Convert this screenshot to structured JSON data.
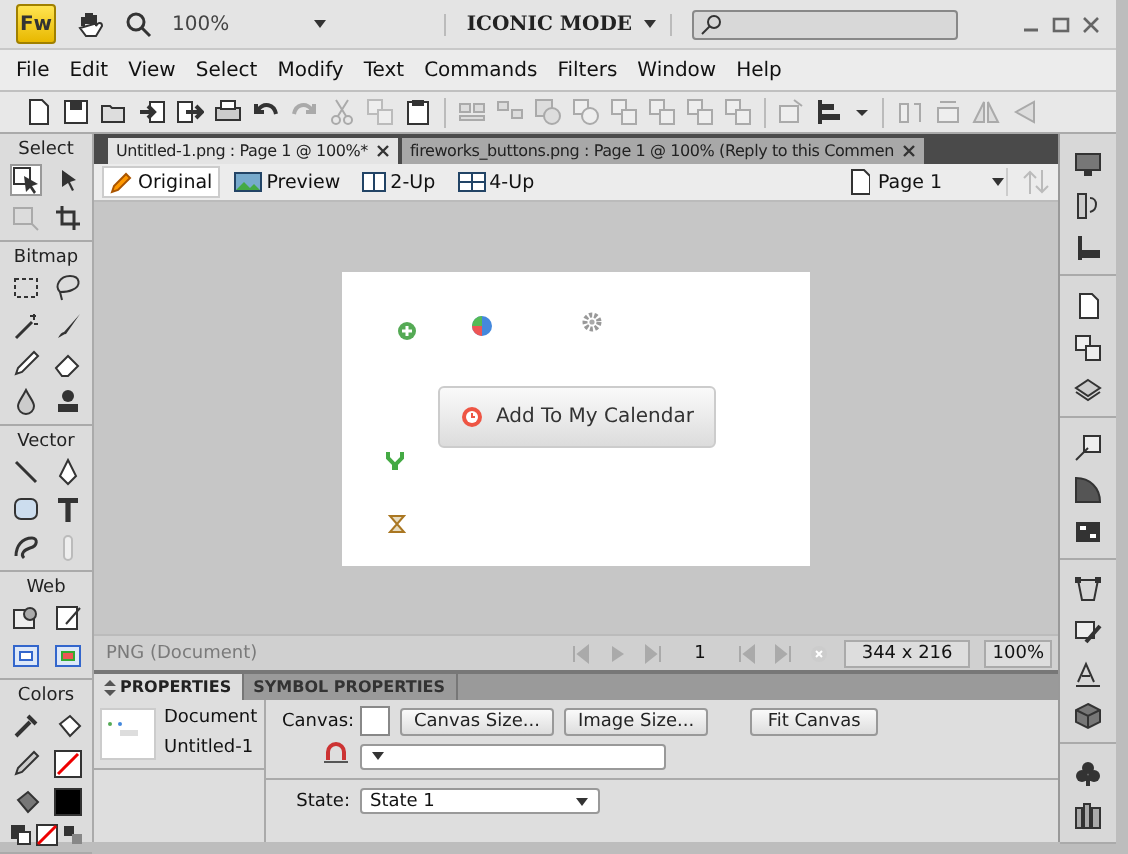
{
  "title_bar": {
    "logo": "Fw",
    "zoom": "100%",
    "workspace": "ICONIC MODE"
  },
  "menu": [
    "File",
    "Edit",
    "View",
    "Select",
    "Modify",
    "Text",
    "Commands",
    "Filters",
    "Window",
    "Help"
  ],
  "document_tabs": [
    {
      "label": "Untitled-1.png : Page 1 @ 100%*",
      "selected": true
    },
    {
      "label": "fireworks_buttons.png : Page 1 @ 100% (Reply to this Commen",
      "selected": false
    }
  ],
  "view_tabs": [
    {
      "label": "Original",
      "selected": true
    },
    {
      "label": "Preview",
      "selected": false
    },
    {
      "label": "2-Up",
      "selected": false
    },
    {
      "label": "4-Up",
      "selected": false
    }
  ],
  "page_selector": "Page 1",
  "tool_groups": [
    {
      "label": "Select"
    },
    {
      "label": "Bitmap"
    },
    {
      "label": "Vector"
    },
    {
      "label": "Web"
    },
    {
      "label": "Colors"
    }
  ],
  "canvas": {
    "button_label": "Add To My Calendar"
  },
  "status_bar": {
    "document_type": "PNG (Document)",
    "frame": "1",
    "size": "344 x 216",
    "zoom": "100%"
  },
  "properties": {
    "tabs": [
      {
        "label": "PROPERTIES",
        "selected": true
      },
      {
        "label": "SYMBOL PROPERTIES",
        "selected": false
      }
    ],
    "object_type": "Document",
    "object_name": "Untitled-1",
    "canvas_label": "Canvas:",
    "buttons": [
      "Canvas Size...",
      "Image Size...",
      "Fit Canvas"
    ],
    "state_label": "State:",
    "state_value": "State 1"
  }
}
